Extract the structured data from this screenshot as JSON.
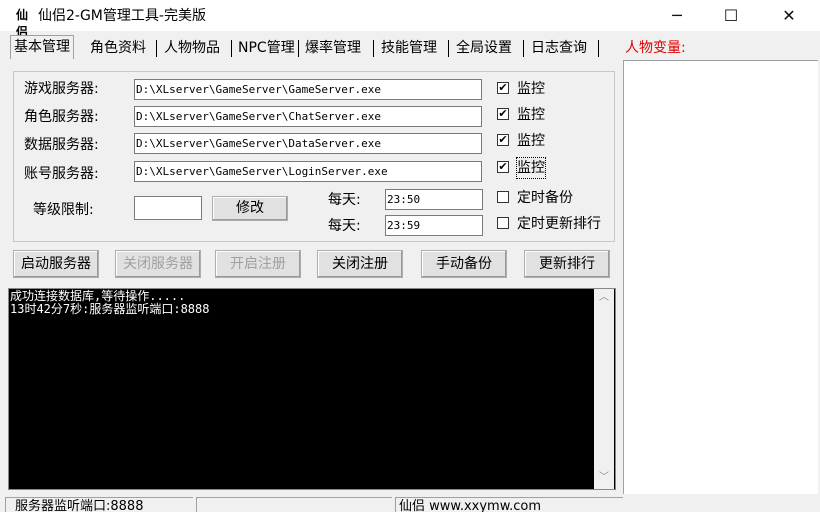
{
  "window": {
    "title": "仙侣2-GM管理工具-完美版",
    "icon_text": "仙侣",
    "minimize": "─",
    "maximize": "☐",
    "close": "✕"
  },
  "tabs": [
    {
      "label": "基本管理",
      "active": true
    },
    {
      "label": "角色资料"
    },
    {
      "label": "人物物品"
    },
    {
      "label": "NPC管理"
    },
    {
      "label": "爆率管理"
    },
    {
      "label": "技能管理"
    },
    {
      "label": "全局设置"
    },
    {
      "label": "日志查询"
    }
  ],
  "var_panel": {
    "label": "人物变量:"
  },
  "servers": [
    {
      "label": "游戏服务器:",
      "path": "D:\\XLserver\\GameServer\\GameServer.exe",
      "monitor_label": "监控",
      "checked": true
    },
    {
      "label": "角色服务器:",
      "path": "D:\\XLserver\\GameServer\\ChatServer.exe",
      "monitor_label": "监控",
      "checked": true
    },
    {
      "label": "数据服务器:",
      "path": "D:\\XLserver\\GameServer\\DataServer.exe",
      "monitor_label": "监控",
      "checked": true
    },
    {
      "label": "账号服务器:",
      "path": "D:\\XLserver\\GameServer\\LoginServer.exe",
      "monitor_label": "监控",
      "checked": true
    }
  ],
  "level_limit": {
    "label": "等级限制:",
    "value": "",
    "button": "修改"
  },
  "schedule": [
    {
      "label": "每天:",
      "time": "23:50",
      "option": "定时备份",
      "checked": false
    },
    {
      "label": "每天:",
      "time": "23:59",
      "option": "定时更新排行",
      "checked": false
    }
  ],
  "actions": [
    {
      "label": "启动服务器",
      "enabled": true
    },
    {
      "label": "关闭服务器",
      "enabled": false
    },
    {
      "label": "开启注册",
      "enabled": false
    },
    {
      "label": "关闭注册",
      "enabled": true
    },
    {
      "label": "手动备份",
      "enabled": true
    },
    {
      "label": "更新排行",
      "enabled": true
    }
  ],
  "console": {
    "lines": "成功连接数据库,等待操作.....\n13时42分7秒:服务器监听端口:8888"
  },
  "statusbar": {
    "left": "服务器监听端口:8888",
    "middle": "",
    "right": "仙侣   www.xxymw.com"
  },
  "colors": {
    "var_label": "#e00000",
    "console_bg": "#000000",
    "console_text": "#ffffff"
  }
}
